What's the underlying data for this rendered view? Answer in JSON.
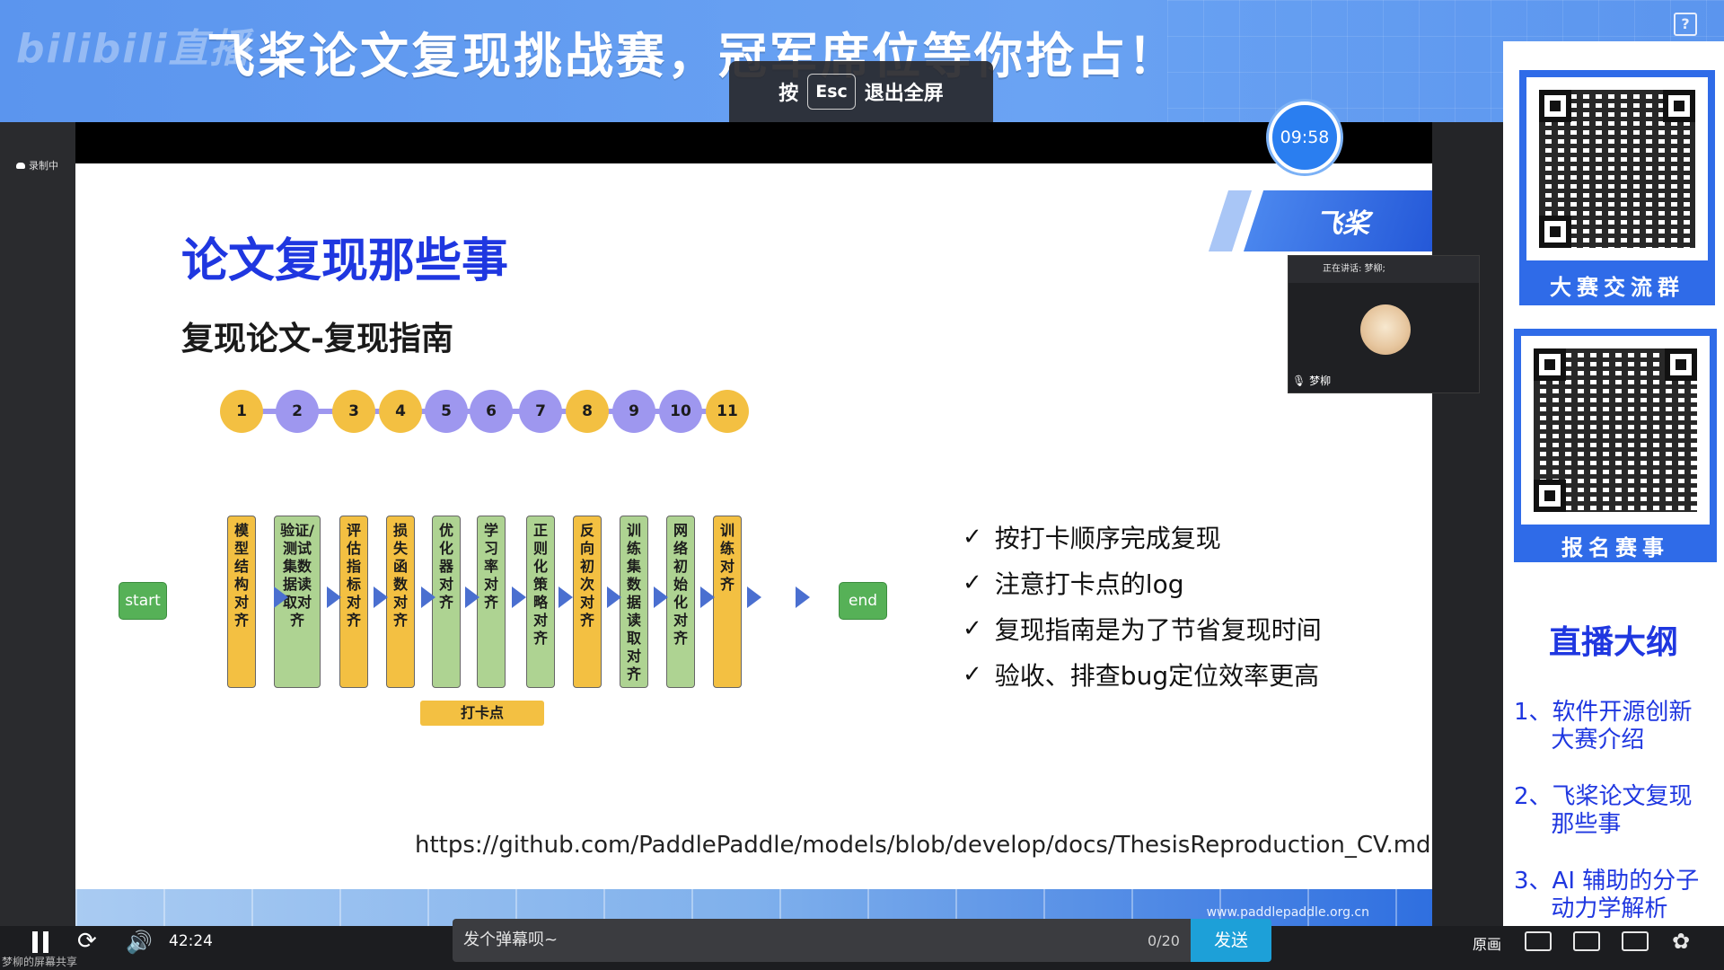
{
  "banner": {
    "logo": "bilibili直播",
    "title": "飞桨论文复现挑战赛，冠军席位等你抢占！",
    "help_icon": "?"
  },
  "esc_hint": {
    "prefix": "按",
    "key": "Esc",
    "suffix": "退出全屏"
  },
  "recording": {
    "label": "录制中"
  },
  "timer": {
    "value": "09:58"
  },
  "slide": {
    "title": "论文复现那些事",
    "subtitle": "复现论文-复现指南",
    "brand_logo": "飞桨",
    "start": "start",
    "end": "end",
    "steps": [
      {
        "num": "1",
        "label": "模型结构对齐",
        "num_color": "orange",
        "box_color": "orange"
      },
      {
        "num": "2",
        "label": "验证/测试集数据读取对齐",
        "num_color": "purple",
        "box_color": "green"
      },
      {
        "num": "3",
        "label": "评估指标对齐",
        "num_color": "orange",
        "box_color": "orange"
      },
      {
        "num": "4",
        "label": "损失函数对齐",
        "num_color": "orange",
        "box_color": "orange"
      },
      {
        "num": "5",
        "label": "优化器对齐",
        "num_color": "purple",
        "box_color": "green"
      },
      {
        "num": "6",
        "label": "学习率对齐",
        "num_color": "purple",
        "box_color": "green"
      },
      {
        "num": "7",
        "label": "正则化策略对齐",
        "num_color": "purple",
        "box_color": "green"
      },
      {
        "num": "8",
        "label": "反向初次对齐",
        "num_color": "orange",
        "box_color": "orange"
      },
      {
        "num": "9",
        "label": "训练集数据读取对齐",
        "num_color": "purple",
        "box_color": "green"
      },
      {
        "num": "10",
        "label": "网络初始化对齐",
        "num_color": "purple",
        "box_color": "green"
      },
      {
        "num": "11",
        "label": "训练对齐",
        "num_color": "orange",
        "box_color": "orange"
      }
    ],
    "checkin_label": "打卡点",
    "checks": [
      "按打卡顺序完成复现",
      "注意打卡点的log",
      "复现指南是为了节省复现时间",
      "验收、排查bug定位效率更高"
    ],
    "check_mark": "✓",
    "url": "https://github.com/PaddlePaddle/models/blob/develop/docs/ThesisReproduction_CV.md",
    "footer_url": "www.paddlepaddle.org.cn"
  },
  "speaker": {
    "status": "正在讲话: 梦柳;",
    "name": "梦柳"
  },
  "sidebar": {
    "qr1_caption": "大赛交流群",
    "qr2_caption": "报名赛事",
    "outline_title": "直播大纲",
    "outline_items": [
      "1、软件开源创新\n     大赛介绍",
      "2、飞桨论文复现\n     那些事",
      "3、AI 辅助的分子\n     动力学解析"
    ]
  },
  "controls": {
    "time": "42:24",
    "share_label": "梦柳的屏幕共享",
    "danmaku_placeholder": "发个弹幕呗~",
    "danmaku_count": "0/20",
    "send": "发送",
    "quality": "原画"
  },
  "colors": {
    "orange": "#f3c042",
    "purple": "#9e97ef",
    "green": "#aed392",
    "accent_blue": "#1f37e0"
  }
}
